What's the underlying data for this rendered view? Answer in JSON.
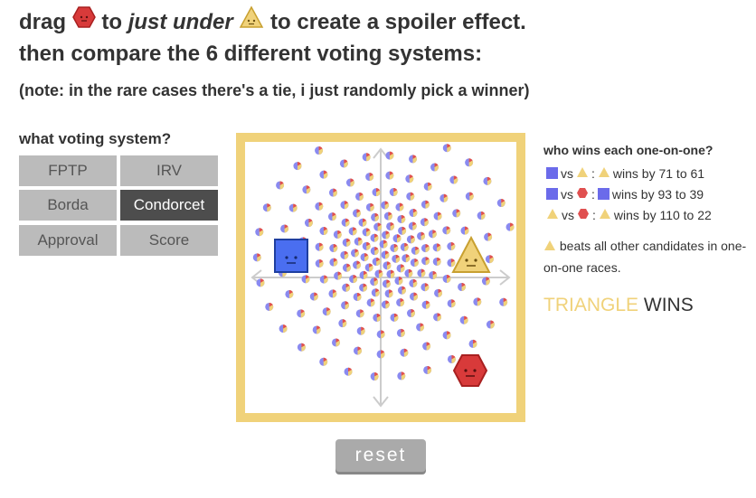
{
  "header": {
    "line1_drag": "drag",
    "line1_to": "to",
    "line1_just_under": "just under",
    "line1_rest": "to create a spoiler effect.",
    "line2": "then compare the 6 different voting systems:",
    "line3": "(note: in the rare cases there's a tie, i just randomly pick a winner)"
  },
  "system_picker": {
    "label": "what voting system?",
    "buttons": [
      {
        "label": "FPTP",
        "active": false
      },
      {
        "label": "IRV",
        "active": false
      },
      {
        "label": "Borda",
        "active": false
      },
      {
        "label": "Condorcet",
        "active": true
      },
      {
        "label": "Approval",
        "active": false
      },
      {
        "label": "Score",
        "active": false
      }
    ]
  },
  "reset_label": "reset",
  "results": {
    "title": "who wins each one-on-one?",
    "pairs": [
      {
        "a": "square-icon",
        "b": "triangle-icon",
        "winner": "triangle-icon",
        "vs": "vs",
        "text": "wins by 71 to 61"
      },
      {
        "a": "square-icon",
        "b": "hexagon-icon",
        "winner": "square-icon",
        "vs": "vs",
        "text": "wins by 93 to 39"
      },
      {
        "a": "triangle-icon",
        "b": "hexagon-icon",
        "winner": "triangle-icon",
        "vs": "vs",
        "text": "wins by 110 to 22"
      }
    ],
    "summary": "beats all other candidates in one-on-one races.",
    "winner_name": "TRIANGLE",
    "winner_suffix": "WINS"
  },
  "colors": {
    "square": "#4a6ef0",
    "triangle": "#f0d27a",
    "hexagon": "#d83a3a",
    "board_border": "#f0d27a",
    "active_button": "#4d4d4d",
    "button": "#bbbbbb"
  }
}
